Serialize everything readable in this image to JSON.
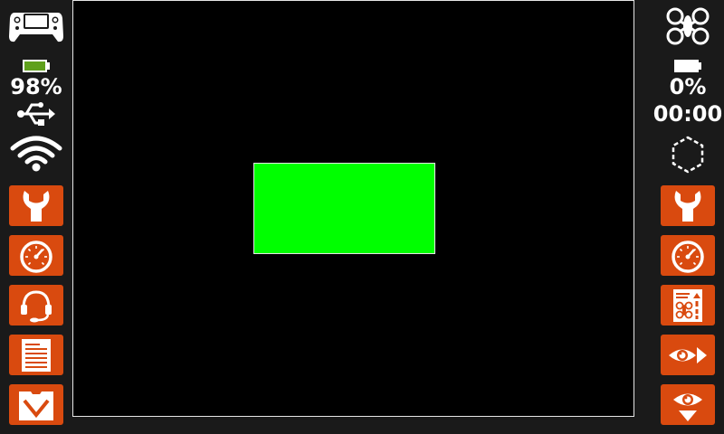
{
  "left_sidebar": {
    "battery_percent": "98%",
    "battery_level": 0.98,
    "icons": [
      "gamepad-icon",
      "battery-icon",
      "usb-icon",
      "wifi-icon"
    ],
    "buttons": [
      "wrench-icon",
      "gauge-icon",
      "headset-icon",
      "document-icon",
      "download-icon"
    ]
  },
  "right_sidebar": {
    "battery_percent": "0%",
    "battery_level": 0.0,
    "timer": "00:00",
    "icons": [
      "drone-icon",
      "battery-icon",
      "hexagon-outline-icon"
    ],
    "buttons": [
      "wrench-icon",
      "gauge-icon",
      "drone-checklist-icon",
      "eye-forward-icon",
      "eye-down-icon"
    ]
  },
  "colors": {
    "accent": "#d94a0f",
    "highlight": "#00ff00",
    "background": "#1a1a1a",
    "viewport": "#000000",
    "battery_fill": "#5fa01c"
  }
}
